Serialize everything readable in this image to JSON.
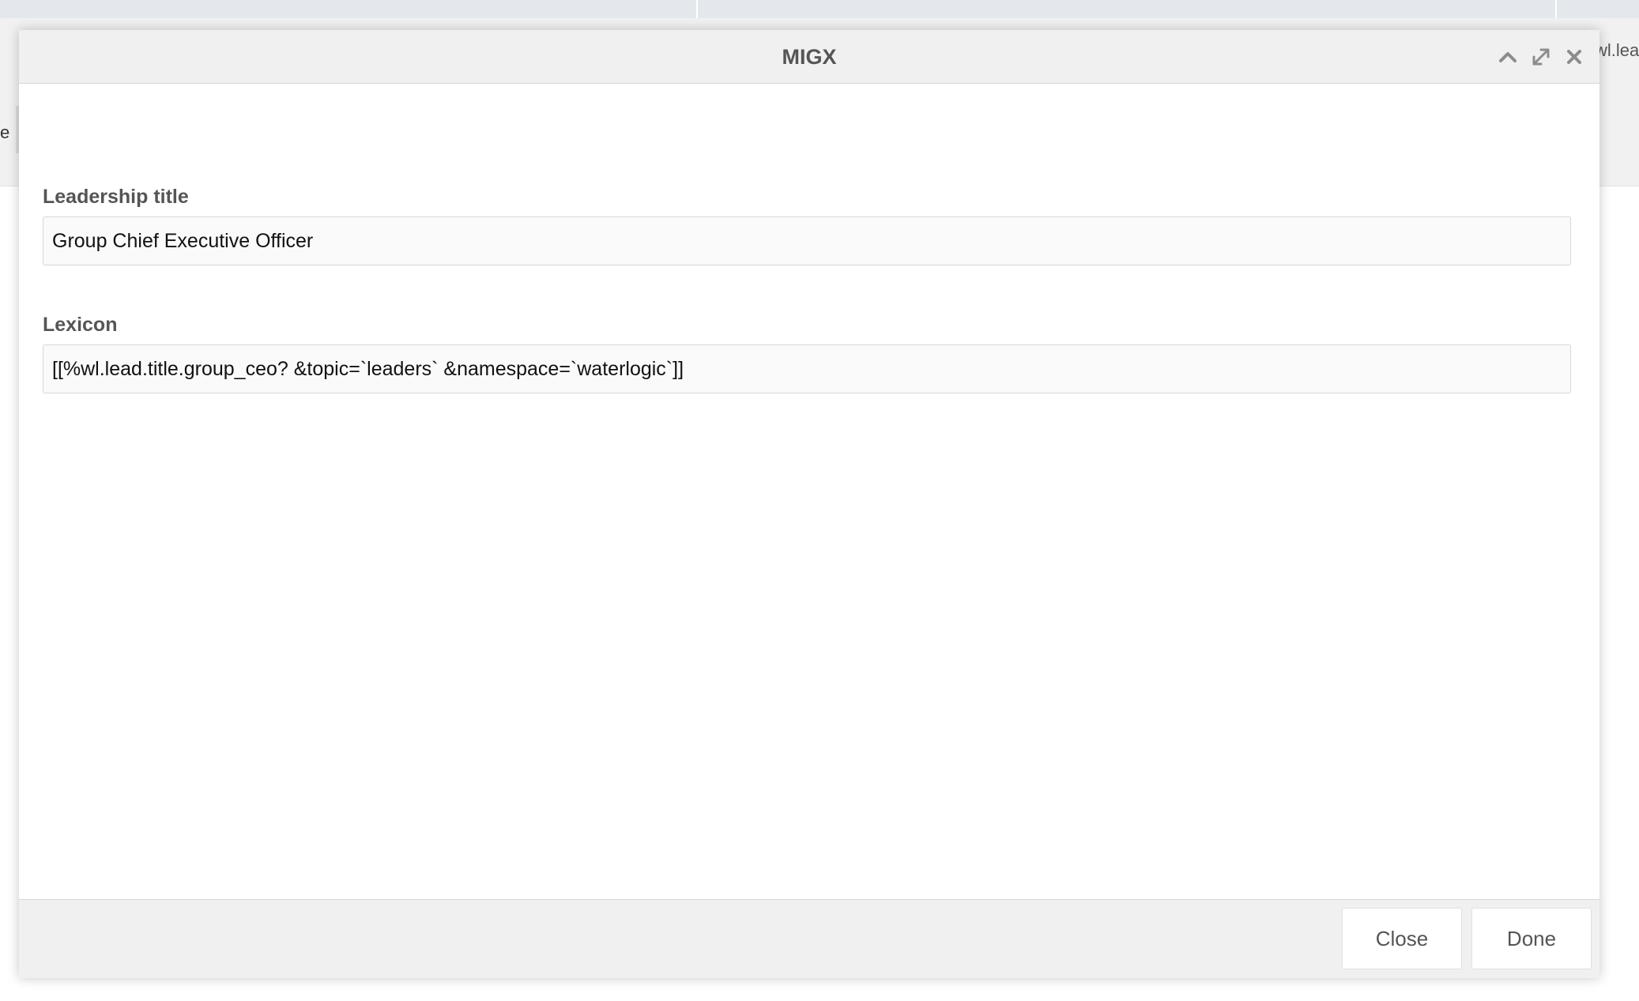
{
  "background": {
    "left_fragment": "e",
    "right_fragment": "wl.lea"
  },
  "modal": {
    "title": "MIGX",
    "header_tools": [
      {
        "name": "collapse",
        "icon": "chevron-up-icon"
      },
      {
        "name": "maximize",
        "icon": "expand-icon"
      },
      {
        "name": "close",
        "icon": "close-icon"
      }
    ],
    "fields": [
      {
        "label": "Leadership title",
        "value": "Group Chief Executive Officer"
      },
      {
        "label": "Lexicon",
        "value": "[[%wl.lead.title.group_ceo? &topic=`leaders` &namespace=`waterlogic`]]"
      }
    ],
    "footer": {
      "close_label": "Close",
      "done_label": "Done"
    }
  },
  "colors": {
    "header_bg": "#f0f0f0",
    "label_text": "#555555",
    "input_bg": "#fafafa",
    "input_border": "#d6d6d6"
  }
}
